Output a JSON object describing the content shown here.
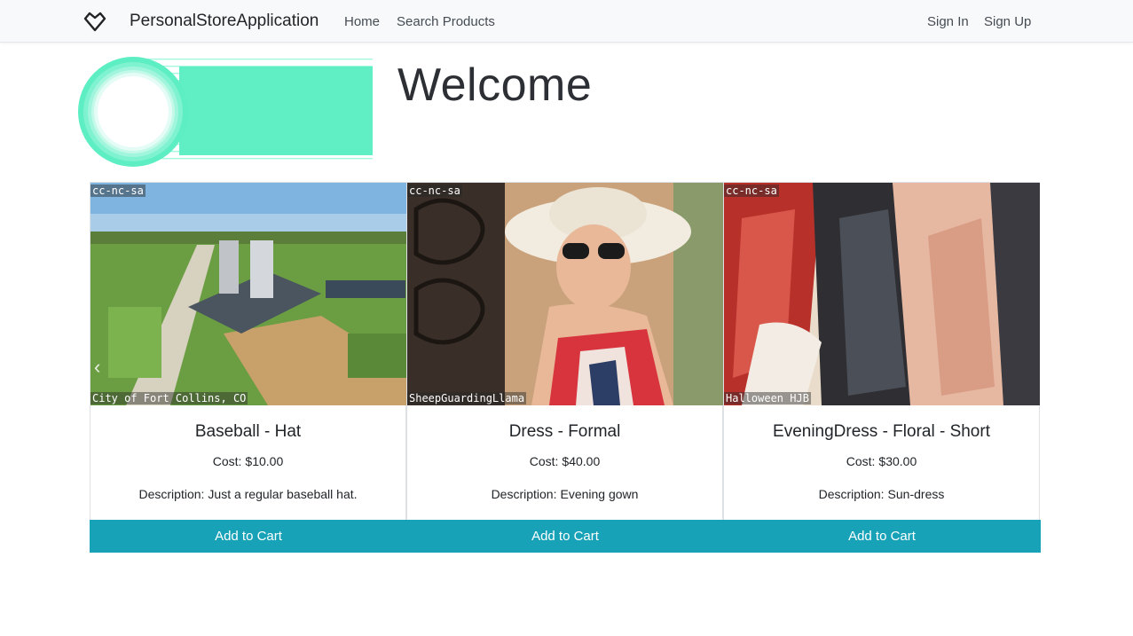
{
  "navbar": {
    "brand": "PersonalStoreApplication",
    "brand_icon": "heart-outline-icon",
    "links": {
      "home": "Home",
      "search": "Search Products"
    },
    "auth": {
      "sign_in": "Sign In",
      "sign_up": "Sign Up"
    }
  },
  "hero": {
    "title": "Welcome",
    "logo_icon": "ring-lines-logo",
    "accent_color": "#5cf0c4"
  },
  "products": [
    {
      "title": "Baseball - Hat",
      "cost_label": "Cost:",
      "cost": "$10.00",
      "desc_label": "Description:",
      "description": "Just a regular baseball hat.",
      "image_license": "cc-nc-sa",
      "image_credit": "City of Fort Collins, CO",
      "button": "Add to Cart"
    },
    {
      "title": "Dress - Formal",
      "cost_label": "Cost:",
      "cost": "$40.00",
      "desc_label": "Description:",
      "description": "Evening gown",
      "image_license": "cc-nc-sa",
      "image_credit": "SheepGuardingLlama",
      "button": "Add to Cart"
    },
    {
      "title": "EveningDress - Floral - Short",
      "cost_label": "Cost:",
      "cost": "$30.00",
      "desc_label": "Description:",
      "description": "Sun-dress",
      "image_license": "cc-nc-sa",
      "image_credit": "Halloween HJB",
      "button": "Add to Cart"
    }
  ],
  "carousel": {
    "prev_icon": "chevron-left-icon"
  },
  "colors": {
    "button": "#17a2b8",
    "navbar_bg": "#f8f9fa"
  }
}
